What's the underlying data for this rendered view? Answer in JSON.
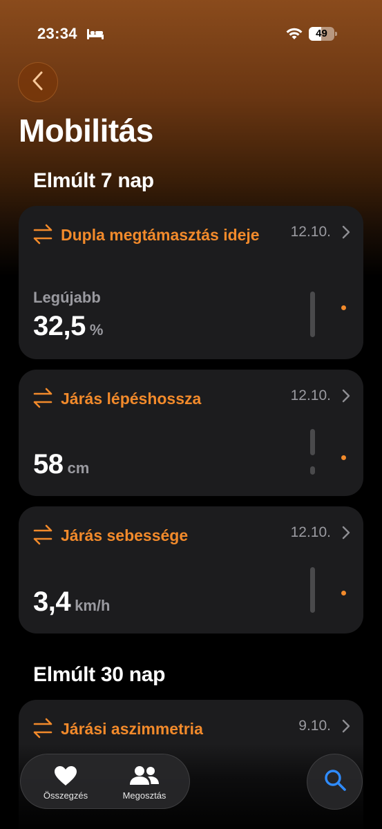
{
  "status_bar": {
    "time": "23:34",
    "battery": "49",
    "battery_level": 0.49
  },
  "header": {
    "title": "Mobilitás"
  },
  "sections": [
    {
      "title": "Elmúlt 7 nap",
      "cards": [
        {
          "title": "Dupla megtámasztás ideje",
          "date": "12.10.",
          "latest_label": "Legújabb",
          "value": "32,5",
          "unit": "%"
        },
        {
          "title": "Járás lépéshossza",
          "date": "12.10.",
          "value": "58",
          "unit": "cm"
        },
        {
          "title": "Járás sebessége",
          "date": "12.10.",
          "value": "3,4",
          "unit": "km/h"
        }
      ]
    },
    {
      "title": "Elmúlt 30 nap",
      "cards": [
        {
          "title": "Járási aszimmetria",
          "date": "9.10."
        }
      ]
    }
  ],
  "tab_bar": {
    "tabs": [
      {
        "label": "Összegzés",
        "icon": "heart-icon"
      },
      {
        "label": "Megosztás",
        "icon": "people-icon"
      }
    ],
    "search_icon": "search-icon"
  },
  "colors": {
    "accent": "#f28a2b",
    "card_bg": "#1c1c1e",
    "secondary_text": "#9a9aa0",
    "search_blue": "#2f8cff"
  }
}
